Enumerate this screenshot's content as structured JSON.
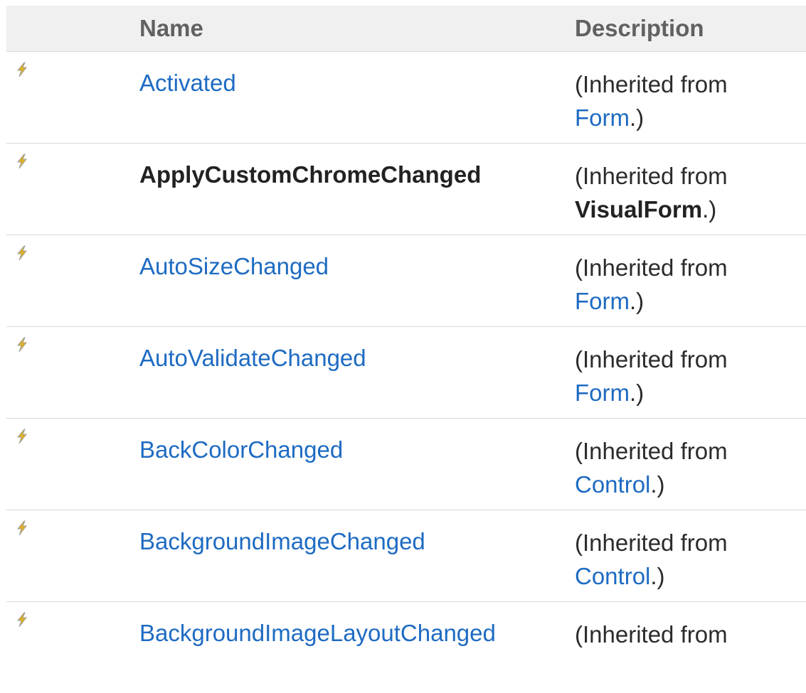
{
  "colors": {
    "header_bg": "#f0f0f0",
    "header_text": "#616161",
    "link": "#1e6bc2",
    "text": "#2b2b2b",
    "divider": "#d8d8d8"
  },
  "table": {
    "headers": {
      "icon": "",
      "name": "Name",
      "description": "Description"
    },
    "rows": [
      {
        "icon": "event-icon",
        "name": "Activated",
        "name_is_link": true,
        "desc_prefix": "(Inherited from",
        "desc_class": "Form",
        "desc_class_is_link": true,
        "desc_suffix": ".)"
      },
      {
        "icon": "event-icon",
        "name": "ApplyCustomChromeChanged",
        "name_is_link": false,
        "desc_prefix": "(Inherited from",
        "desc_class": "VisualForm",
        "desc_class_is_link": false,
        "desc_suffix": ".)"
      },
      {
        "icon": "event-icon",
        "name": "AutoSizeChanged",
        "name_is_link": true,
        "desc_prefix": "(Inherited from",
        "desc_class": "Form",
        "desc_class_is_link": true,
        "desc_suffix": ".)"
      },
      {
        "icon": "event-icon",
        "name": "AutoValidateChanged",
        "name_is_link": true,
        "desc_prefix": "(Inherited from",
        "desc_class": "Form",
        "desc_class_is_link": true,
        "desc_suffix": ".)"
      },
      {
        "icon": "event-icon",
        "name": "BackColorChanged",
        "name_is_link": true,
        "desc_prefix": "(Inherited from",
        "desc_class": "Control",
        "desc_class_is_link": true,
        "desc_suffix": ".)"
      },
      {
        "icon": "event-icon",
        "name": "BackgroundImageChanged",
        "name_is_link": true,
        "desc_prefix": "(Inherited from",
        "desc_class": "Control",
        "desc_class_is_link": true,
        "desc_suffix": ".)"
      },
      {
        "icon": "event-icon",
        "name": "BackgroundImageLayoutChanged",
        "name_is_link": true,
        "desc_prefix": "(Inherited from",
        "desc_class": "",
        "desc_class_is_link": true,
        "desc_suffix": ""
      }
    ]
  }
}
